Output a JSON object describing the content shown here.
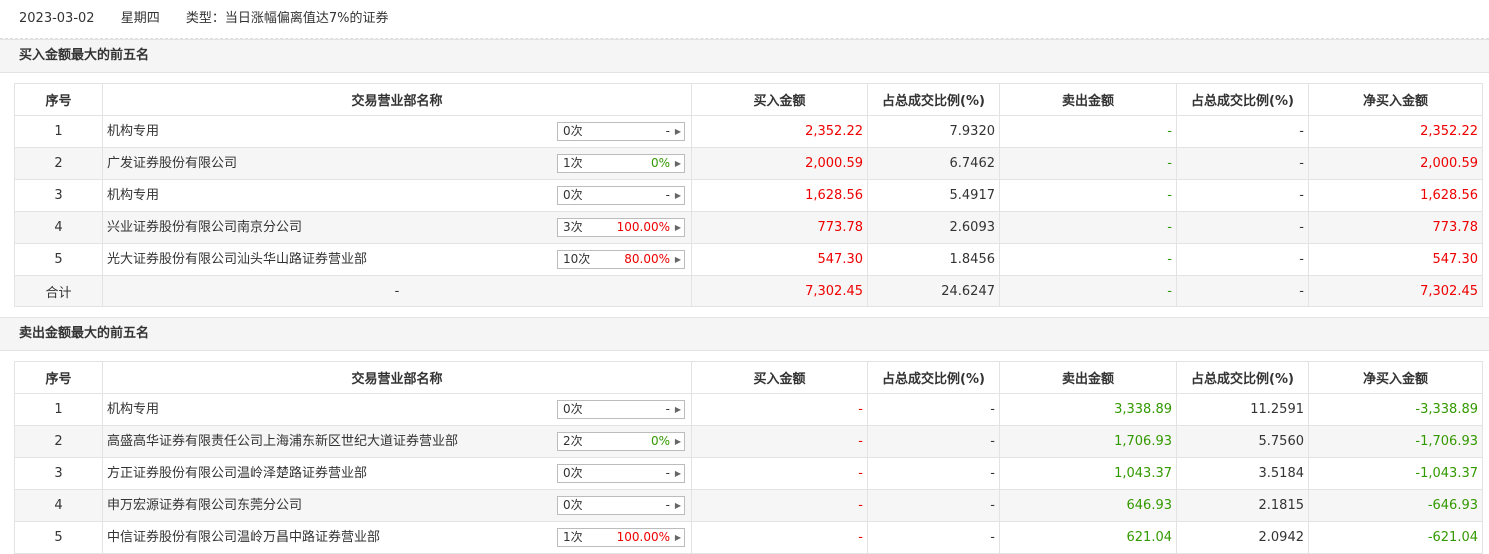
{
  "header": {
    "date": "2023-03-02",
    "weekday": "星期四",
    "type": "类型：当日涨幅偏离值达7%的证券"
  },
  "buy_section": {
    "title": "买入金额最大的前五名",
    "columns": [
      "序号",
      "交易营业部名称",
      "买入金额",
      "占总成交比例(%)",
      "卖出金额",
      "占总成交比例(%)",
      "净买入金额"
    ],
    "rows": [
      {
        "no": "1",
        "name": "机构专用",
        "count": "0次",
        "rate": "-",
        "buy": "2,352.22",
        "buy_ratio": "7.9320",
        "sell": "-",
        "sell_ratio": "-",
        "net": "2,352.22"
      },
      {
        "no": "2",
        "name": "广发证券股份有限公司",
        "count": "1次",
        "rate": "0%",
        "buy": "2,000.59",
        "buy_ratio": "6.7462",
        "sell": "-",
        "sell_ratio": "-",
        "net": "2,000.59"
      },
      {
        "no": "3",
        "name": "机构专用",
        "count": "0次",
        "rate": "-",
        "buy": "1,628.56",
        "buy_ratio": "5.4917",
        "sell": "-",
        "sell_ratio": "-",
        "net": "1,628.56"
      },
      {
        "no": "4",
        "name": "兴业证券股份有限公司南京分公司",
        "count": "3次",
        "rate": "100.00%",
        "buy": "773.78",
        "buy_ratio": "2.6093",
        "sell": "-",
        "sell_ratio": "-",
        "net": "773.78"
      },
      {
        "no": "5",
        "name": "光大证券股份有限公司汕头华山路证券营业部",
        "count": "10次",
        "rate": "80.00%",
        "buy": "547.30",
        "buy_ratio": "1.8456",
        "sell": "-",
        "sell_ratio": "-",
        "net": "547.30"
      }
    ],
    "total": {
      "label": "合计",
      "name": "-",
      "buy": "7,302.45",
      "buy_ratio": "24.6247",
      "sell": "-",
      "sell_ratio": "-",
      "net": "7,302.45"
    }
  },
  "sell_section": {
    "title": "卖出金额最大的前五名",
    "columns": [
      "序号",
      "交易营业部名称",
      "买入金额",
      "占总成交比例(%)",
      "卖出金额",
      "占总成交比例(%)",
      "净买入金额"
    ],
    "rows": [
      {
        "no": "1",
        "name": "机构专用",
        "count": "0次",
        "rate": "-",
        "buy": "-",
        "buy_ratio": "-",
        "sell": "3,338.89",
        "sell_ratio": "11.2591",
        "net": "-3,338.89"
      },
      {
        "no": "2",
        "name": "高盛高华证券有限责任公司上海浦东新区世纪大道证券营业部",
        "count": "2次",
        "rate": "0%",
        "buy": "-",
        "buy_ratio": "-",
        "sell": "1,706.93",
        "sell_ratio": "5.7560",
        "net": "-1,706.93"
      },
      {
        "no": "3",
        "name": "方正证券股份有限公司温岭泽楚路证券营业部",
        "count": "0次",
        "rate": "-",
        "buy": "-",
        "buy_ratio": "-",
        "sell": "1,043.37",
        "sell_ratio": "3.5184",
        "net": "-1,043.37"
      },
      {
        "no": "4",
        "name": "申万宏源证券有限公司东莞分公司",
        "count": "0次",
        "rate": "-",
        "buy": "-",
        "buy_ratio": "-",
        "sell": "646.93",
        "sell_ratio": "2.1815",
        "net": "-646.93"
      },
      {
        "no": "5",
        "name": "中信证券股份有限公司温岭万昌中路证券营业部",
        "count": "1次",
        "rate": "100.00%",
        "buy": "-",
        "buy_ratio": "-",
        "sell": "621.04",
        "sell_ratio": "2.0942",
        "net": "-621.04"
      }
    ]
  },
  "colors": {
    "red": "#ee0000",
    "green": "#339900",
    "border": "#e3e3e3",
    "alt_row": "#f6f6f6"
  },
  "icons": {
    "picker_arrow": "triangle-right-icon"
  }
}
